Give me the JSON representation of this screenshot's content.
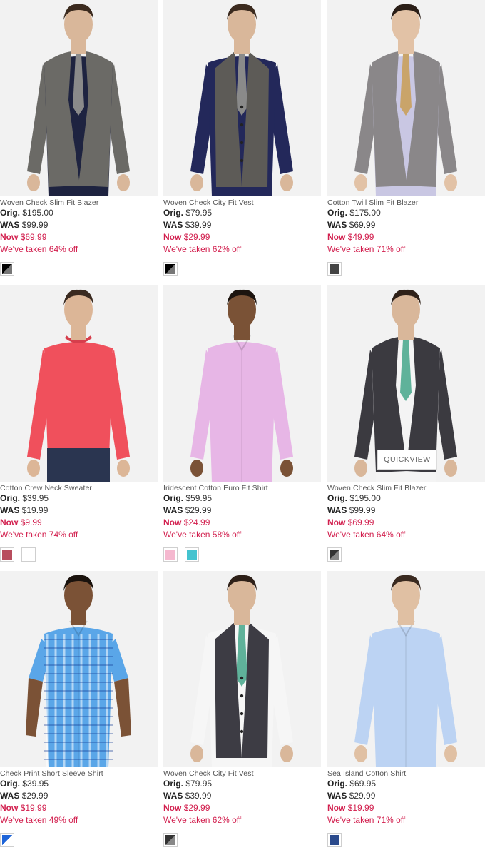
{
  "labels": {
    "orig": "Orig.",
    "was": "WAS",
    "now": "Now"
  },
  "products": [
    {
      "name": "Woven Check Slim Fit Blazer",
      "orig": "$195.00",
      "was": "$99.99",
      "now": "$69.99",
      "discount": "We've taken 64% off",
      "swatches": [
        "split:#000000:#777777"
      ],
      "outfit": {
        "type": "blazer",
        "jacket": "#6b6a66",
        "shirt": "#1e2340",
        "tie": "#8a8a8a",
        "skin": "#d9b79a",
        "hair": "#3b2a1e"
      }
    },
    {
      "name": "Woven Check City Fit Vest",
      "orig": "$79.95",
      "was": "$39.99",
      "now": "$29.99",
      "discount": "We've taken 62% off",
      "swatches": [
        "split:#000000:#777777"
      ],
      "outfit": {
        "type": "vest",
        "jacket": "#5d5b57",
        "shirt": "#23285a",
        "tie": "#8a8a8a",
        "skin": "#d9b79a",
        "hair": "#3b2a1e"
      }
    },
    {
      "name": "Cotton Twill Slim Fit Blazer",
      "orig": "$175.00",
      "was": "$69.99",
      "now": "$49.99",
      "discount": "We've taken 71% off",
      "swatches": [
        "solid:#444444"
      ],
      "outfit": {
        "type": "blazer",
        "jacket": "#8a8789",
        "shirt": "#c9c7e3",
        "tie": "#c9a46a",
        "skin": "#e2c2a6",
        "hair": "#2a1e17"
      }
    },
    {
      "name": "Cotton Crew Neck Sweater",
      "orig": "$39.95",
      "was": "$19.99",
      "now": "$9.99",
      "discount": "We've taken 74% off",
      "swatches": [
        "solid:#b84d5e",
        "solid:#ffffff"
      ],
      "outfit": {
        "type": "sweater",
        "jacket": "#f0505c",
        "shirt": "#f0505c",
        "tie": "",
        "skin": "#dcb697",
        "hair": "#3a2a20"
      }
    },
    {
      "name": "Iridescent Cotton Euro Fit Shirt",
      "orig": "$59.95",
      "was": "$29.99",
      "now": "$24.99",
      "discount": "We've taken 58% off",
      "swatches": [
        "solid:#f5b8cf",
        "solid:#44c3cf"
      ],
      "outfit": {
        "type": "shirt",
        "jacket": "#e7b6e6",
        "shirt": "#e7b6e6",
        "tie": "",
        "skin": "#7a5236",
        "hair": "#1c140f"
      }
    },
    {
      "name": "Woven Check Slim Fit Blazer",
      "orig": "$195.00",
      "was": "$99.99",
      "now": "$69.99",
      "discount": "We've taken 64% off",
      "swatches": [
        "split:#333333:#888888"
      ],
      "outfit": {
        "type": "blazer",
        "jacket": "#3b3a40",
        "shirt": "#f4f4f4",
        "tie": "#5fb29a",
        "skin": "#d9b79a",
        "hair": "#2e2018"
      }
    },
    {
      "name": "Check Print Short Sleeve Shirt",
      "orig": "$39.95",
      "was": "$29.99",
      "now": "$19.99",
      "discount": "We've taken 49% off",
      "swatches": [
        "split:#1e64d8:#ffffff"
      ],
      "outfit": {
        "type": "short",
        "jacket": "#5aa6e8",
        "shirt": "#5aa6e8",
        "tie": "",
        "skin": "#7b5236",
        "hair": "#1a120d"
      }
    },
    {
      "name": "Woven Check City Fit Vest",
      "orig": "$79.95",
      "was": "$39.99",
      "now": "$29.99",
      "discount": "We've taken 62% off",
      "swatches": [
        "split:#333333:#888888"
      ],
      "outfit": {
        "type": "vest",
        "jacket": "#3d3c44",
        "shirt": "#f6f6f6",
        "tie": "#5fb29a",
        "skin": "#d9b79a",
        "hair": "#2e2018"
      }
    },
    {
      "name": "Sea Island Cotton Shirt",
      "orig": "$69.95",
      "was": "$29.99",
      "now": "$19.99",
      "discount": "We've taken 71% off",
      "swatches": [
        "solid:#2b4a8c"
      ],
      "outfit": {
        "type": "shirt",
        "jacket": "#bcd3f3",
        "shirt": "#bcd3f3",
        "tie": "",
        "skin": "#e0c0a3",
        "hair": "#3a2a20"
      }
    }
  ],
  "quickview": {
    "label": "QUICKVIEW"
  }
}
